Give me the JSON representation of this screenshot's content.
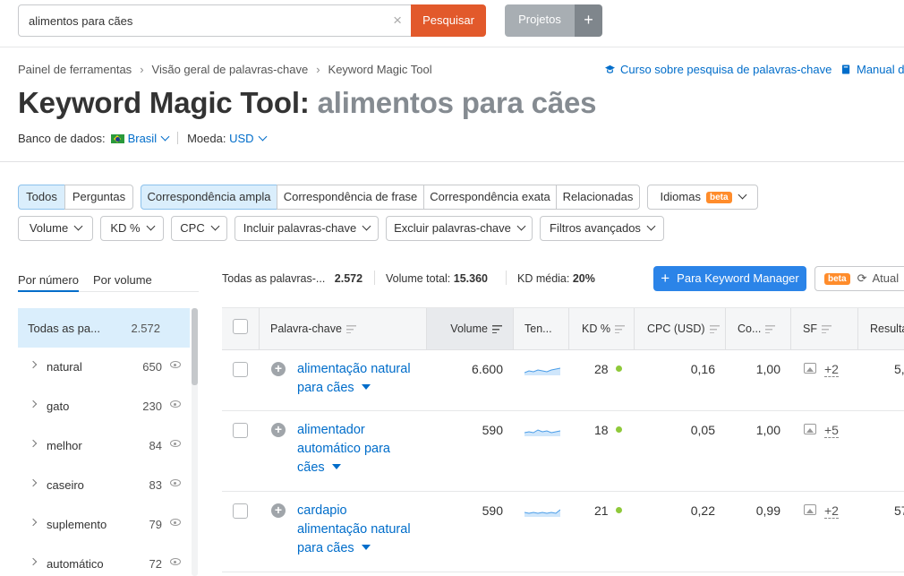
{
  "search": {
    "value": "alimentos para cães",
    "clear_icon": "×",
    "button": "Pesquisar"
  },
  "projects": {
    "button": "Projetos",
    "plus": "+"
  },
  "breadcrumb": [
    "Painel de ferramentas",
    "Visão geral de palavras-chave",
    "Keyword Magic Tool"
  ],
  "breadcrumb_sep": "›",
  "top_links": {
    "course": "Curso sobre pesquisa de palavras-chave",
    "manual": "Manual d"
  },
  "title": {
    "tool": "Keyword Magic Tool:",
    "keyword": "alimentos para cães"
  },
  "database": {
    "label": "Banco de dados:",
    "value": "Brasil",
    "currency_label": "Moeda:",
    "currency": "USD"
  },
  "filters": {
    "todos": "Todos",
    "perguntas": "Perguntas",
    "ampla": "Correspondência ampla",
    "frase": "Correspondência de frase",
    "exata": "Correspondência exata",
    "relacionadas": "Relacionadas",
    "idiomas": "Idiomas",
    "beta": "beta",
    "volume": "Volume",
    "kd": "KD %",
    "cpc": "CPC",
    "incluir": "Incluir palavras-chave",
    "excluir": "Excluir palavras-chave",
    "avancados": "Filtros avançados"
  },
  "left_tabs": {
    "by_number": "Por número",
    "by_volume": "Por volume"
  },
  "summary": {
    "all_label": "Todas as palavras-...",
    "all_value": "2.572",
    "volume_label": "Volume total:",
    "volume_value": "15.360",
    "kd_label": "KD média:",
    "kd_value": "20%"
  },
  "keyword_manager_btn": "Para Keyword Manager",
  "update_btn": {
    "beta": "beta",
    "label": "Atual"
  },
  "groups_all": {
    "label": "Todas as pa...",
    "count": "2.572"
  },
  "groups": [
    {
      "label": "natural",
      "count": "650"
    },
    {
      "label": "gato",
      "count": "230"
    },
    {
      "label": "melhor",
      "count": "84"
    },
    {
      "label": "caseiro",
      "count": "83"
    },
    {
      "label": "suplemento",
      "count": "79"
    },
    {
      "label": "automático",
      "count": "72"
    }
  ],
  "table": {
    "headers": {
      "keyword": "Palavra-chave",
      "volume": "Volume",
      "trend": "Ten...",
      "kd": "KD %",
      "cpc": "CPC (USD)",
      "com": "Co...",
      "sf": "SF",
      "results": "Resulta"
    },
    "rows": [
      {
        "kw": [
          "alimentação natural",
          "para cães"
        ],
        "volume": "6.600",
        "kd": "28",
        "cpc": "0,16",
        "com": "1,00",
        "sf": "+2",
        "results": "5,"
      },
      {
        "kw": [
          "alimentador",
          "automático para",
          "cães"
        ],
        "volume": "590",
        "kd": "18",
        "cpc": "0,05",
        "com": "1,00",
        "sf": "+5",
        "results": ""
      },
      {
        "kw": [
          "cardapio",
          "alimentação natural",
          "para cães"
        ],
        "volume": "590",
        "kd": "21",
        "cpc": "0,22",
        "com": "0,99",
        "sf": "+2",
        "results": "57"
      }
    ]
  },
  "colors": {
    "accent": "#006dca",
    "search_button": "#e2592b",
    "kd_dot": "#8fc93a",
    "beta": "#ff8c2b"
  }
}
